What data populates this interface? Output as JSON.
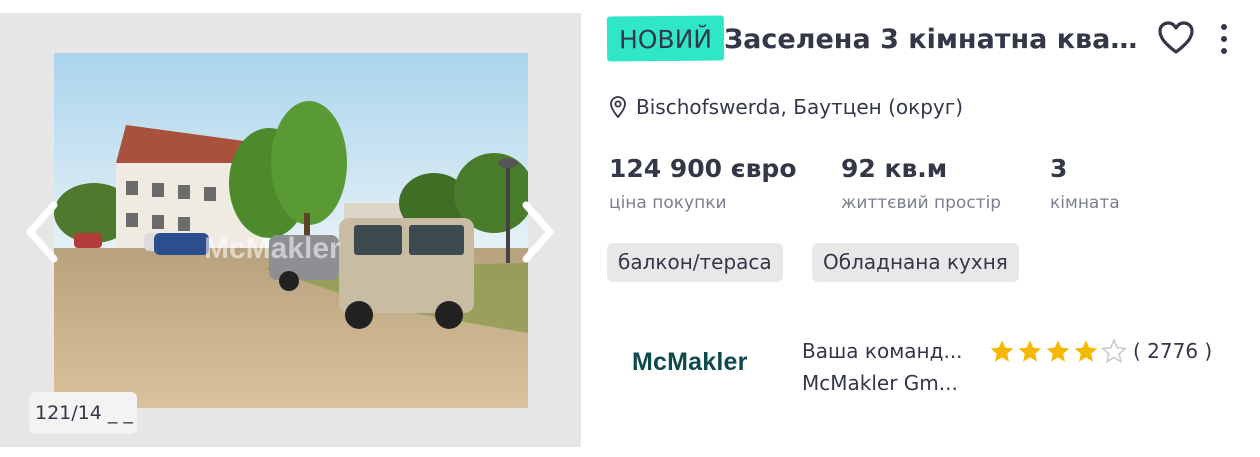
{
  "listing": {
    "badge": "НОВИЙ",
    "title": "Заселена 3 кімнатна кварт...",
    "location": "Bischofswerda, Баутцен (округ)",
    "photo_counter": "121/14 _ _",
    "stats": {
      "price_value": "124 900 євро",
      "price_label": "ціна покупки",
      "area_value": "92 кв.м",
      "area_label": "життєвий простір",
      "rooms_value": "3",
      "rooms_label": "кімната"
    },
    "tags": [
      "балкон/тераса",
      "Обладнана кухня"
    ],
    "photo_watermark": "McMakler"
  },
  "agent": {
    "logo_text": "McMakler",
    "line1": "Ваша команд...",
    "line2": "McMakler Gm...",
    "rating_stars": 4,
    "rating_max": 5,
    "rating_count": "( 2776 )"
  },
  "icons": {
    "prev": "chevron-left-icon",
    "next": "chevron-right-icon",
    "favorite": "heart-outline-icon",
    "more": "more-vertical-icon",
    "location": "map-pin-icon",
    "star": "star-icon"
  },
  "colors": {
    "badge_bg": "#2fe6c7",
    "text": "#333748",
    "muted": "#7b7f8e",
    "tag_bg": "#e8e8e8",
    "star": "#f5b800",
    "logo": "#0d4a4e"
  }
}
